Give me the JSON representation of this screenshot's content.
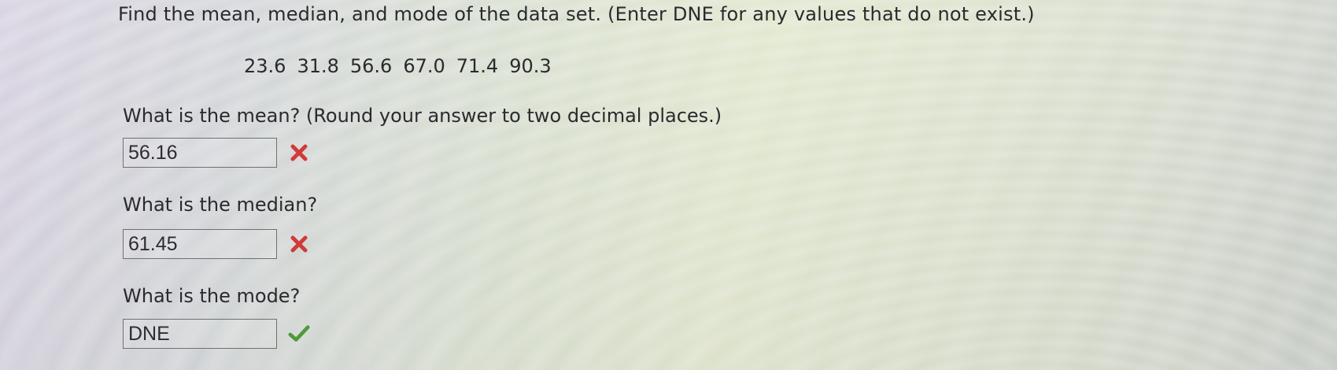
{
  "question": {
    "text": "Find the mean, median, and mode of the data set. (Enter DNE for any values that do not exist.)"
  },
  "dataset": {
    "values": [
      "23.6",
      "31.8",
      "56.6",
      "67.0",
      "71.4",
      "90.3"
    ]
  },
  "parts": {
    "mean": {
      "prompt": "What is the mean? (Round your answer to two decimal places.)",
      "answer": "56.16",
      "status": "incorrect",
      "status_icon": "x-mark-icon",
      "status_color": "#d23a3a"
    },
    "median": {
      "prompt": "What is the median?",
      "answer": "61.45",
      "status": "incorrect",
      "status_icon": "x-mark-icon",
      "status_color": "#d23a3a"
    },
    "mode": {
      "prompt": "What is the mode?",
      "answer": "DNE",
      "status": "correct",
      "status_icon": "check-mark-icon",
      "status_color": "#4f9a3a"
    }
  }
}
